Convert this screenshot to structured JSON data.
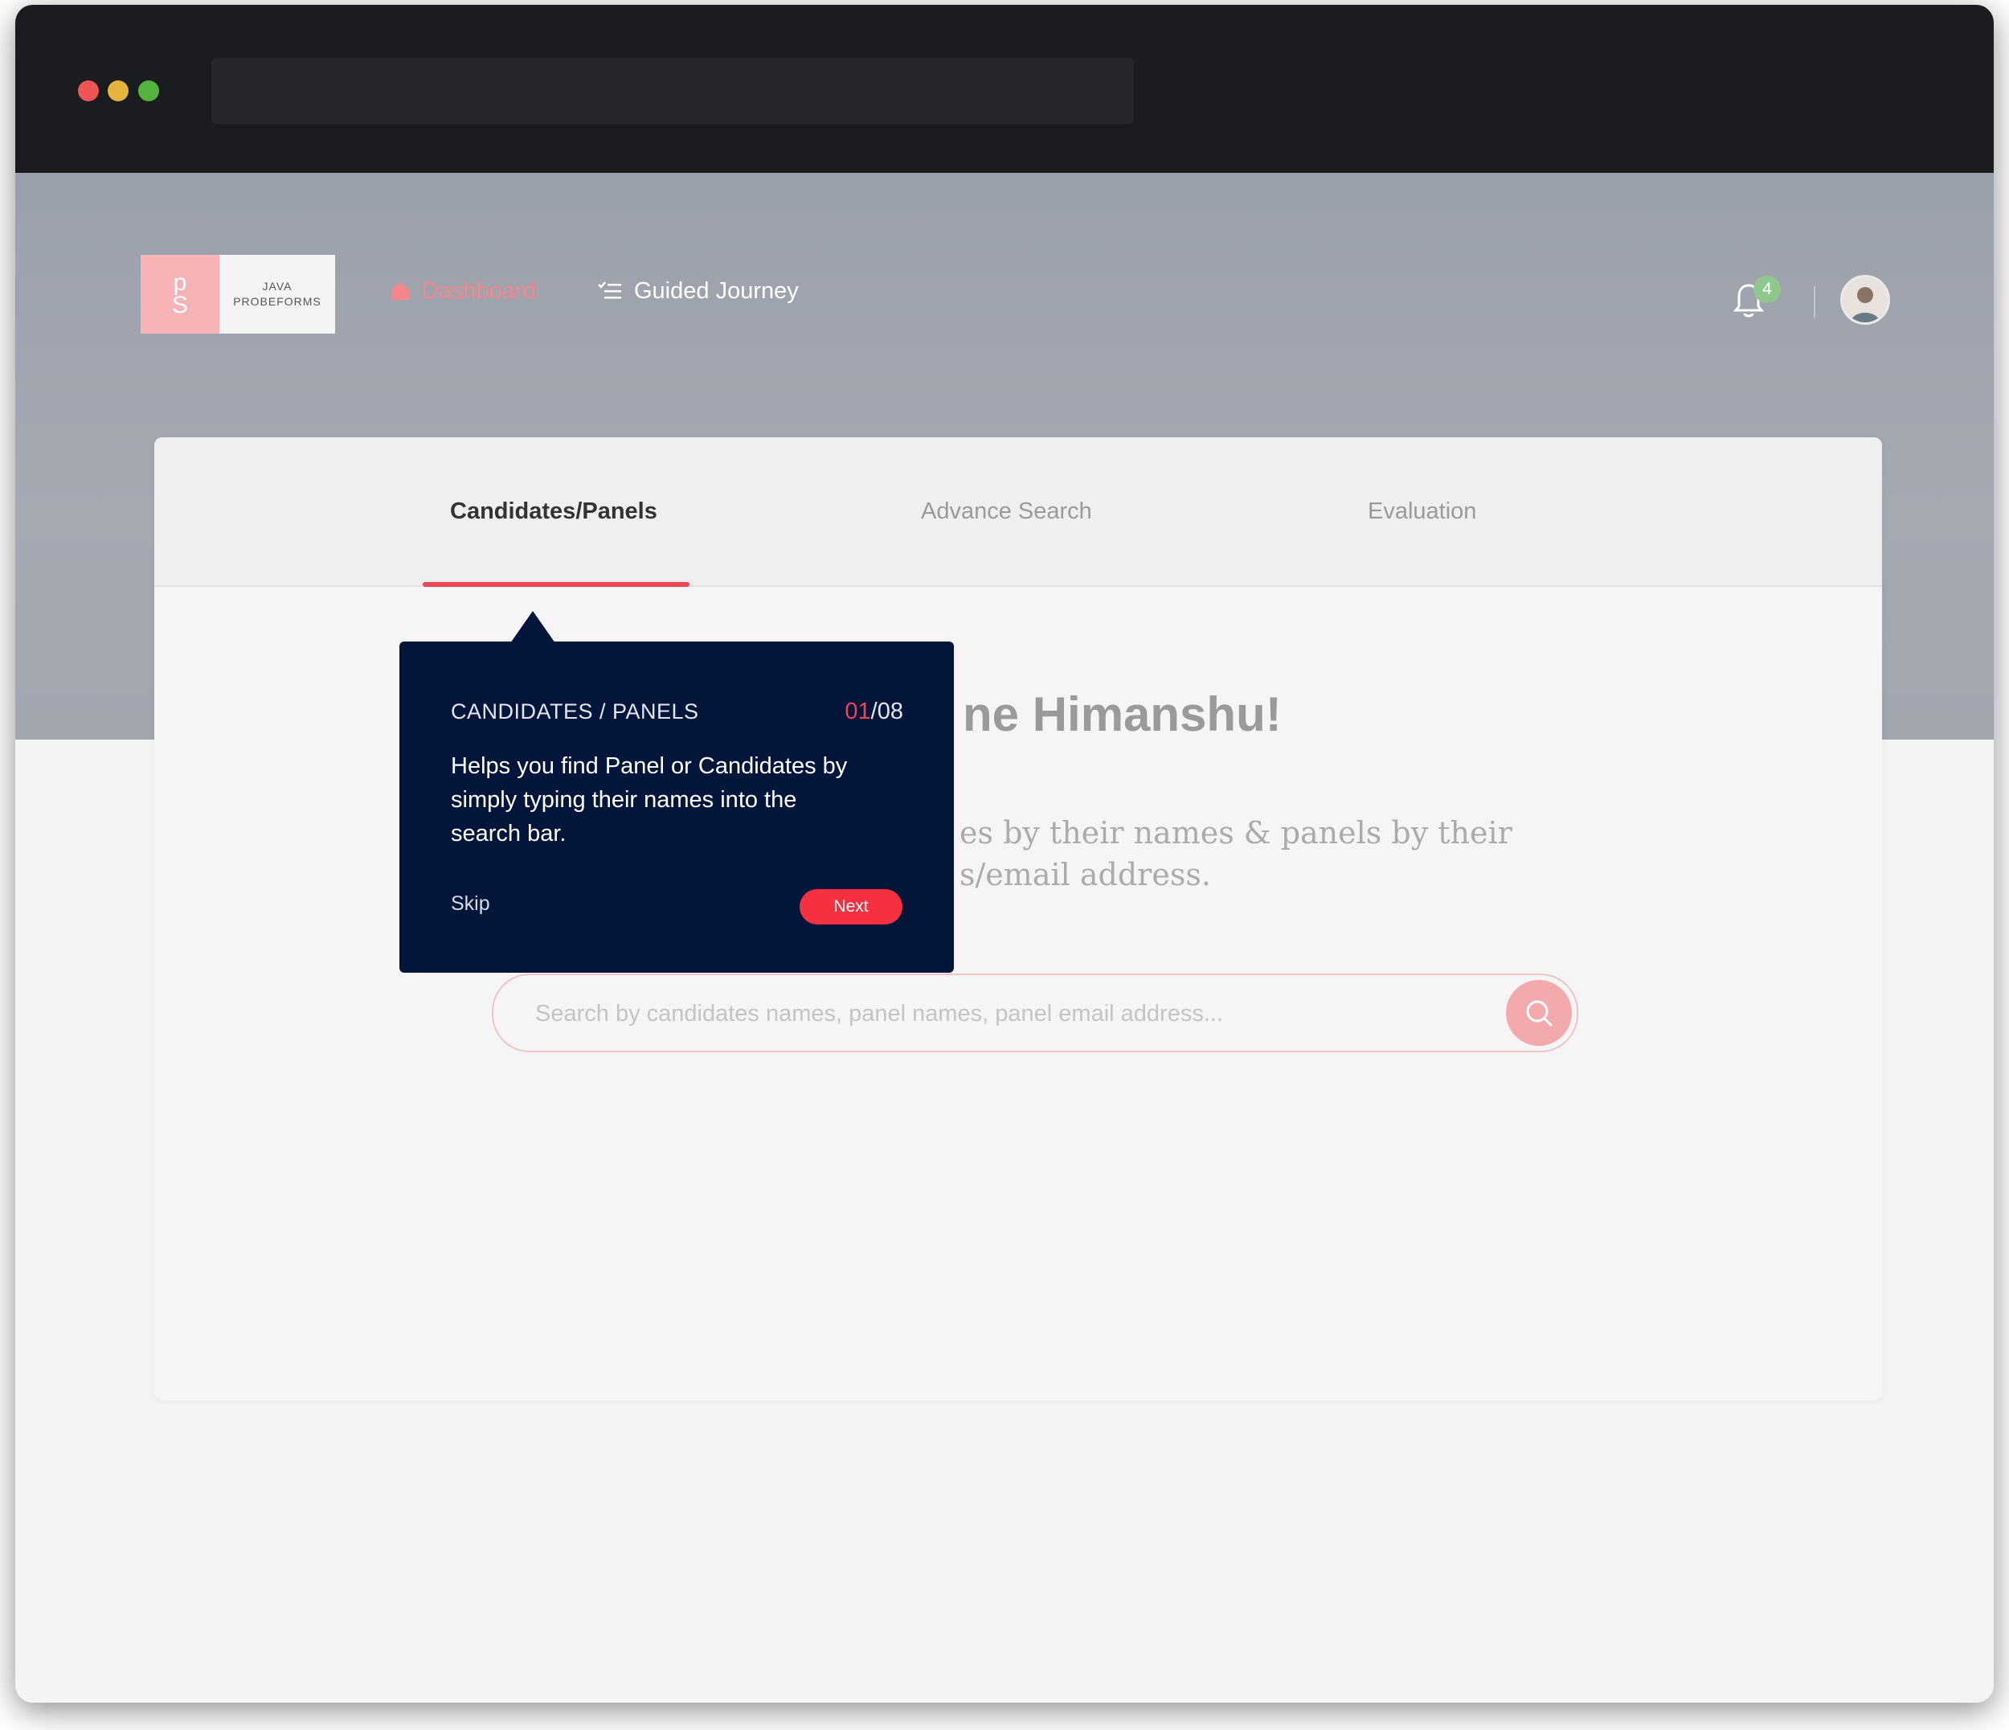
{
  "logo": {
    "mark_top": "p",
    "mark_bottom": "S",
    "line1": "JAVA",
    "line2": "PROBEFORMS"
  },
  "nav": {
    "dashboard": "Dashboard",
    "guided_journey": "Guided Journey"
  },
  "notifications": {
    "count": "4"
  },
  "tabs": [
    {
      "label": "Candidates/Panels",
      "active": true
    },
    {
      "label": "Advance Search",
      "active": false
    },
    {
      "label": "Evaluation",
      "active": false
    }
  ],
  "main": {
    "welcome_visible": "ne Himanshu!",
    "subtitle_line1": "es by their names & panels by their",
    "subtitle_line2": "s/email address."
  },
  "search": {
    "placeholder": "Search by candidates names, panel names, panel email address..."
  },
  "tooltip": {
    "title": "CANDIDATES / PANELS",
    "step_current": "01",
    "step_total": "/08",
    "body": "Helps you find Panel or Candidates by simply typing their names into the search bar.",
    "skip": "Skip",
    "next": "Next"
  },
  "colors": {
    "accent": "#f14452",
    "tooltip_bg": "#02163c",
    "logo_pink": "#f6b3b5",
    "badge_green": "#8fc88d"
  },
  "icons": {
    "dashboard": "home-icon",
    "guided_journey": "list-check-icon",
    "notifications": "bell-icon",
    "search": "search-icon"
  }
}
